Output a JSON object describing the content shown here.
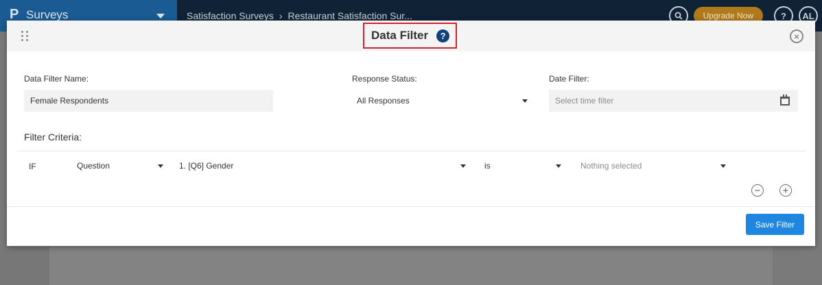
{
  "app": {
    "name": "Surveys",
    "breadcrumbs": [
      "Satisfaction Surveys",
      "Restaurant Satisfaction Sur..."
    ],
    "upgrade_label": "Upgrade Now",
    "help_label": "?",
    "user_initials": "AL"
  },
  "modal": {
    "title": "Data Filter",
    "help_glyph": "?",
    "close_glyph": "×",
    "filter_name": {
      "label": "Data Filter Name:",
      "value": "Female Respondents"
    },
    "response_status": {
      "label": "Response Status:",
      "value": "All Responses"
    },
    "date_filter": {
      "label": "Date Filter:",
      "placeholder": "Select time filter"
    },
    "criteria": {
      "title": "Filter Criteria:",
      "row": {
        "connector": "IF",
        "type": "Question",
        "question": "1. [Q6] Gender",
        "operator": "is",
        "value_placeholder": "Nothing selected"
      },
      "remove_glyph": "−",
      "add_glyph": "+"
    },
    "save_label": "Save Filter"
  },
  "colors": {
    "accent": "#2087e0",
    "highlight_border": "#d3202c",
    "help_icon": "#12407a"
  }
}
